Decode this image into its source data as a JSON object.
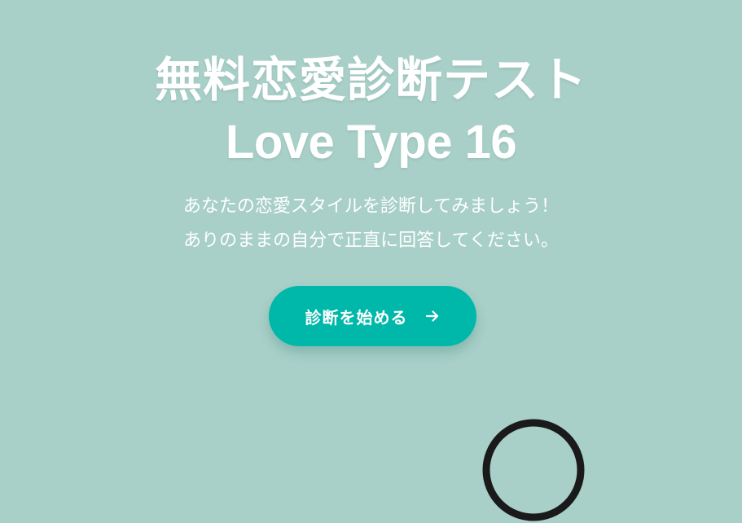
{
  "hero": {
    "title_line1": "無料恋愛診断テスト",
    "title_line2": "Love Type 16",
    "description_line1": "あなたの恋愛スタイルを診断してみましょう！",
    "description_line2": "ありのままの自分で正直に回答してください。",
    "cta_label": "診断を始める",
    "cta_icon": "arrow-right-icon"
  },
  "colors": {
    "background": "#a8d0c8",
    "accent": "#00b8aa",
    "text": "#ffffff",
    "decoration": "#1a1a1a"
  }
}
